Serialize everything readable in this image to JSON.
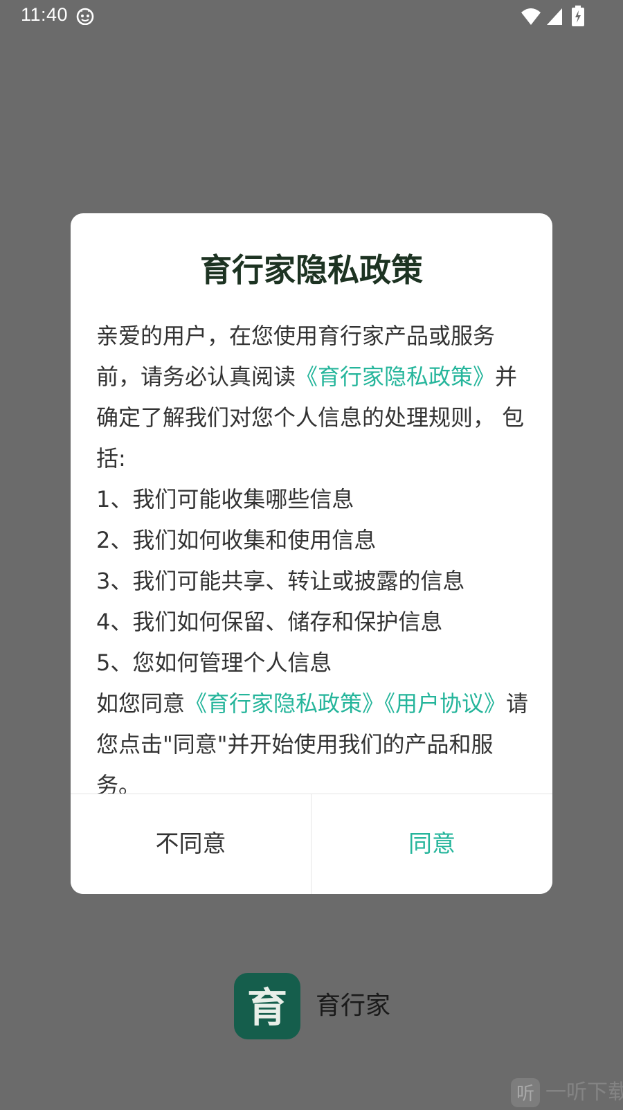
{
  "status_bar": {
    "time": "11:40",
    "icons": [
      "app-notification-icon",
      "wifi-icon",
      "signal-icon",
      "battery-charging-icon"
    ]
  },
  "dialog": {
    "title": "育行家隐私政策",
    "paragraph_1": {
      "prefix": "亲爱的用户，在您使用育行家产品或服务前，请务必认真阅读",
      "link": "《育行家隐私政策》",
      "suffix": "并确定了解我们对您个人信息的处理规则， 包括:"
    },
    "items": [
      "1、我们可能收集哪些信息",
      "2、我们如何收集和使用信息",
      "3、我们可能共享、转让或披露的信息",
      "4、我们如何保留、储存和保护信息",
      "5、您如何管理个人信息"
    ],
    "paragraph_2": {
      "prefix": "如您同意",
      "link_privacy": "《育行家隐私政策》",
      "link_agreement": "《用户协议》",
      "suffix": "请您点击\"同意\"并开始使用我们的产品和服务。"
    },
    "buttons": {
      "disagree": "不同意",
      "agree": "同意"
    }
  },
  "brand": {
    "logo_char": "育",
    "name": "育行家"
  },
  "watermark": {
    "icon_char": "听",
    "text": "一听下载"
  },
  "colors": {
    "overlay": "#6b6b6b",
    "accent": "#25b59b",
    "title": "#1d3322",
    "logo_bg": "#155e4c"
  }
}
